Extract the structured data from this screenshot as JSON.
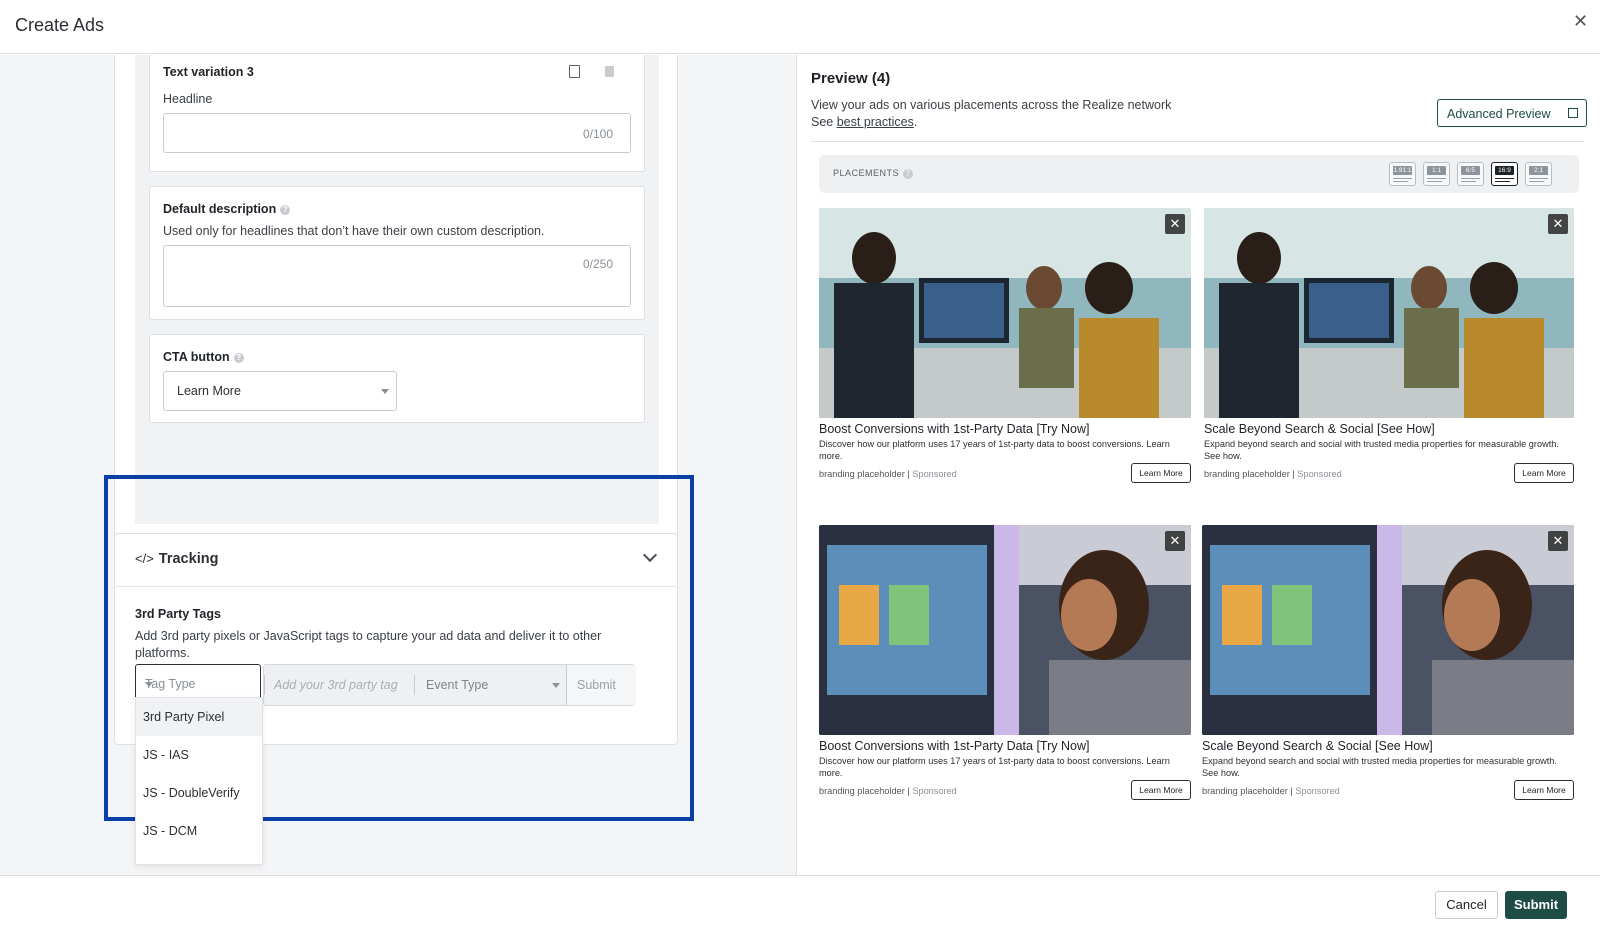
{
  "window": {
    "title": "Create Ads"
  },
  "text_variation": {
    "title": "Text variation 3",
    "headline_label": "Headline",
    "headline_value": "",
    "headline_counter": "0/100"
  },
  "default_description": {
    "label": "Default description",
    "help": "Used only for headlines that don’t have their own custom description.",
    "value": "",
    "counter": "0/250"
  },
  "cta": {
    "label": "CTA button",
    "selected": "Learn More"
  },
  "tracking": {
    "title": "Tracking",
    "icon": "</>",
    "tags_label": "3rd Party Tags",
    "tags_desc": "Add 3rd party pixels or JavaScript tags to capture your ad data and deliver it to other platforms.",
    "tag_type_placeholder": "Tag Type",
    "tag_input_placeholder": "Add your 3rd party tag",
    "event_type_placeholder": "Event Type",
    "submit_label": "Submit",
    "dropdown_options": [
      "3rd Party Pixel",
      "JS - IAS",
      "JS - DoubleVerify",
      "JS - DCM"
    ]
  },
  "preview": {
    "title": "Preview (4)",
    "desc_line1": "View your ads on various placements across the Realize network",
    "desc_see": "See ",
    "desc_link": "best practices",
    "desc_end": ".",
    "advanced_button": "Advanced Preview",
    "placements_label": "PLACEMENTS",
    "ratios": [
      "1.91:1",
      "1:1",
      "6:5",
      "16:9",
      "2:1"
    ],
    "active_ratio": "16:9",
    "ads": [
      {
        "headline": "Boost Conversions with 1st-Party Data [Try Now]",
        "description": "Discover how our platform uses 17 years of 1st-party data to boost conversions. Learn more.",
        "brand": "branding placeholder",
        "sponsored": "Sponsored",
        "cta": "Learn More"
      },
      {
        "headline": "Scale Beyond Search & Social [See How]",
        "description": "Expand beyond search and social with trusted media properties for measurable growth. See how.",
        "brand": "branding placeholder",
        "sponsored": "Sponsored",
        "cta": "Learn More"
      },
      {
        "headline": "Boost Conversions with 1st-Party Data [Try Now]",
        "description": "Discover how our platform uses 17 years of 1st-party data to boost conversions. Learn more.",
        "brand": "branding placeholder",
        "sponsored": "Sponsored",
        "cta": "Learn More"
      },
      {
        "headline": "Scale Beyond Search & Social [See How]",
        "description": "Expand beyond search and social with trusted media properties for measurable growth. See how.",
        "brand": "branding placeholder",
        "sponsored": "Sponsored",
        "cta": "Learn More"
      }
    ]
  },
  "footer": {
    "cancel": "Cancel",
    "submit": "Submit"
  },
  "colors": {
    "accent": "#1d4d45",
    "highlight_border": "#0b3fa8"
  },
  "icons": [
    "close-icon",
    "copy-icon",
    "trash-icon",
    "help-icon",
    "code-icon",
    "chevron-down-icon",
    "external-link-icon"
  ]
}
